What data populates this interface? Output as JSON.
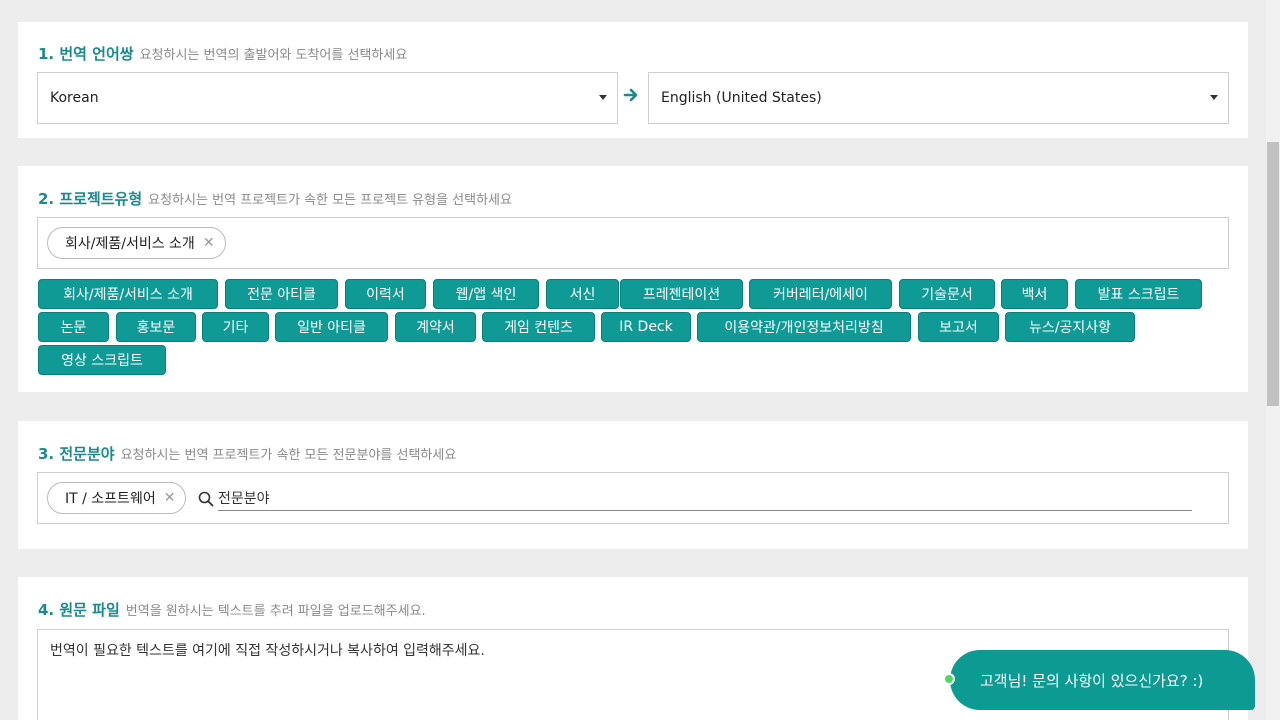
{
  "sections": {
    "language": {
      "title": "1. 번역 언어쌍",
      "hint": "요청하시는 번역의 출발어와 도착어를 선택하세요",
      "source": "Korean",
      "target": "English (United States)"
    },
    "project": {
      "title": "2. 프로젝트유형",
      "hint": "요청하시는 번역 프로젝트가 속한 모든 프로젝트 유형을 선택하세요",
      "selected": "회사/제품/서비스 소개",
      "options": [
        "회사/제품/서비스 소개",
        "전문 아티클",
        "이력서",
        "웹/앱 색인",
        "서신",
        "프레젠테이션",
        "커버레터/에세이",
        "기술문서",
        "백서",
        "발표 스크립트",
        "논문",
        "홍보문",
        "기타",
        "일반 아티클",
        "계약서",
        "게임 컨텐츠",
        "IR Deck",
        "이용약관/개인정보처리방침",
        "보고서",
        "뉴스/공지사항",
        "영상 스크립트"
      ]
    },
    "field": {
      "title": "3. 전문분야",
      "hint": "요청하시는 번역 프로젝트가 속한 모든 전문분야를 선택하세요",
      "selected": "IT / 소프트웨어",
      "search_placeholder": "전문분야"
    },
    "file": {
      "title": "4. 원문 파일",
      "hint": "번역을 원하시는 텍스트를 추려 파일을 업로드해주세요.",
      "placeholder": "번역이 필요한 텍스트를 여기에 직접 작성하시거나 복사하여 입력해주세요."
    }
  },
  "chat": {
    "label": "고객님! 문의 사항이 있으신가요? :)"
  },
  "colors": {
    "accent": "#1a8a8c",
    "tag_bg": "#0f9a96",
    "chat_bg": "#0c9a93",
    "online": "#4cd964"
  },
  "icons": [
    "caret-down-icon",
    "arrow-right-icon",
    "close-icon",
    "search-icon"
  ]
}
